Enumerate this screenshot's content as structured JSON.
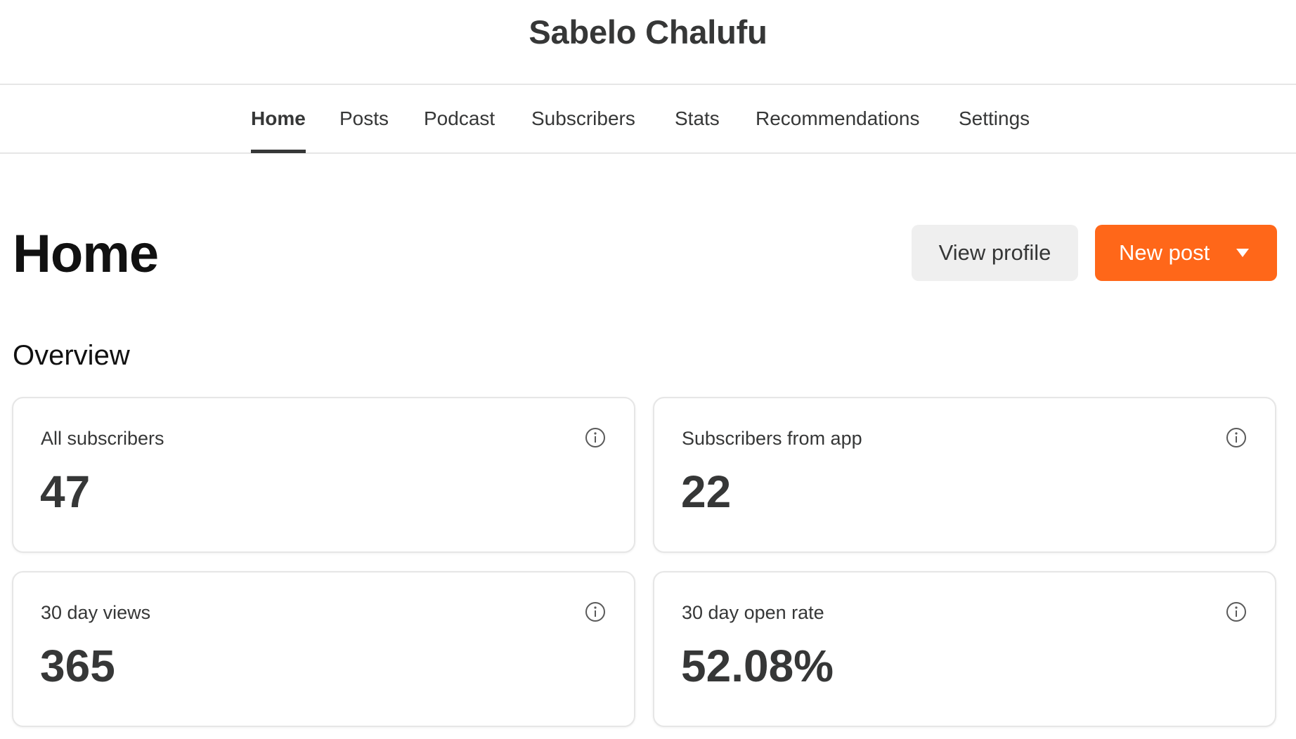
{
  "site": {
    "title": "Sabelo Chalufu"
  },
  "nav": {
    "tabs": [
      {
        "label": "Home",
        "active": true
      },
      {
        "label": "Posts",
        "active": false
      },
      {
        "label": "Podcast",
        "active": false
      },
      {
        "label": "Subscribers",
        "active": false
      },
      {
        "label": "Stats",
        "active": false
      },
      {
        "label": "Recommendations",
        "active": false
      },
      {
        "label": "Settings",
        "active": false
      }
    ]
  },
  "header": {
    "title": "Home",
    "view_profile_label": "View profile",
    "new_post_label": "New post",
    "new_post_icon": "caret-down-icon"
  },
  "overview": {
    "title": "Overview",
    "cards": [
      {
        "label": "All subscribers",
        "value": "47",
        "icon": "info-icon"
      },
      {
        "label": "Subscribers from app",
        "value": "22",
        "icon": "info-icon"
      },
      {
        "label": "30 day views",
        "value": "365",
        "icon": "info-icon"
      },
      {
        "label": "30 day open rate",
        "value": "52.08%",
        "icon": "info-icon"
      }
    ]
  },
  "colors": {
    "accent": "#ff6719",
    "text": "#363737",
    "border": "#e6e6e6",
    "secondary_button": "#efefef"
  }
}
